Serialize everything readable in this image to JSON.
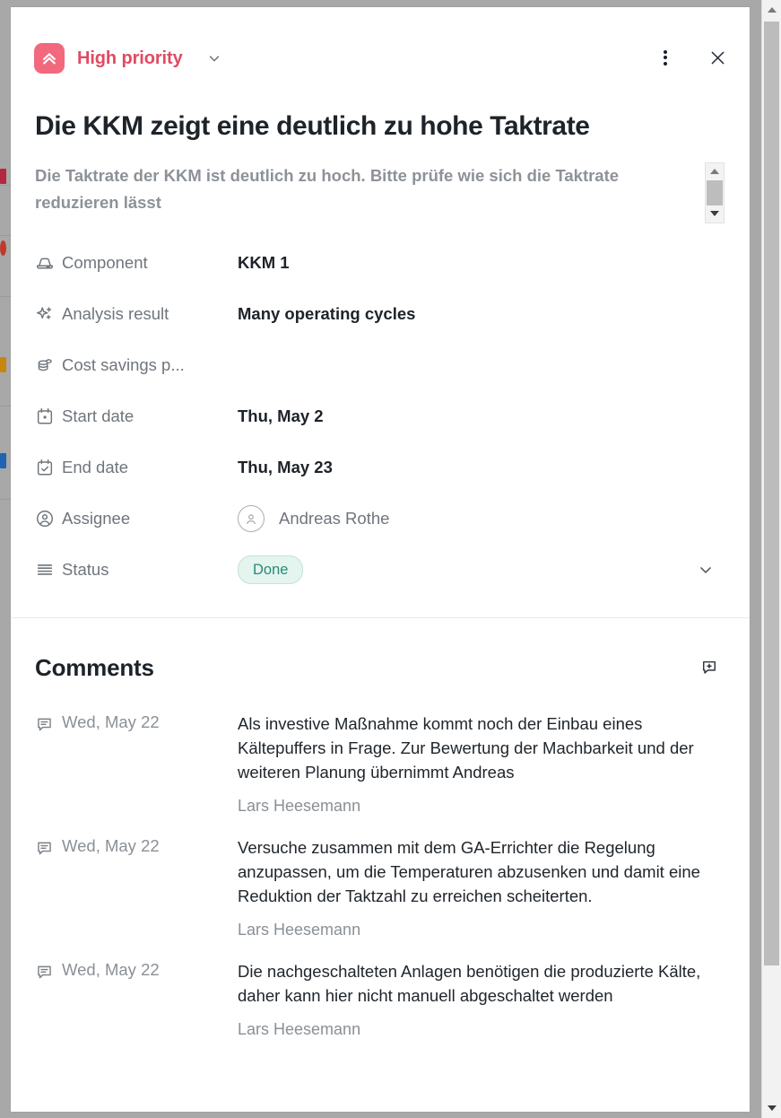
{
  "header": {
    "priority_label": "High priority",
    "priority_icon": "double-chevron-up-icon",
    "priority_color": "#e04a63",
    "priority_badge_color": "#f2687d",
    "caret_icon": "chevron-down-icon",
    "more_icon": "kebab-menu-icon",
    "close_icon": "close-icon"
  },
  "task": {
    "title": "Die KKM zeigt eine deutlich zu hohe Taktrate",
    "description": "Die Taktrate der KKM ist deutlich zu hoch. Bitte prüfe wie sich die Taktrate reduzieren lässt"
  },
  "fields": [
    {
      "icon": "server-icon",
      "label": "Component",
      "value": "KKM 1",
      "style": "bold"
    },
    {
      "icon": "sparkle-icon",
      "label": "Analysis result",
      "value": "Many operating cycles",
      "style": "bold"
    },
    {
      "icon": "coins-icon",
      "label": "Cost savings p...",
      "value": "",
      "style": "bold"
    },
    {
      "icon": "calendar-icon",
      "label": "Start date",
      "value": "Thu, May 2",
      "style": "bold"
    },
    {
      "icon": "calendar-check-icon",
      "label": "End date",
      "value": "Thu, May 23",
      "style": "bold"
    },
    {
      "icon": "user-circle-icon",
      "label": "Assignee",
      "value": "Andreas Rothe",
      "style": "plain"
    },
    {
      "icon": "rows-icon",
      "label": "Status",
      "value": "Done",
      "style": "pill"
    }
  ],
  "status": {
    "badge_text": "Done",
    "badge_bg": "#e4f4ef",
    "badge_text_color": "#2b8a77",
    "caret_icon": "chevron-down-icon"
  },
  "comments": {
    "title": "Comments",
    "add_icon": "add-comment-icon",
    "items": [
      {
        "icon": "comment-icon",
        "date": "Wed, May 22",
        "text": "Als investive Maßnahme kommt noch der Einbau eines Kältepuffers in Frage. Zur Bewertung der Machbarkeit und der weiteren Planung übernimmt Andreas",
        "author": "Lars Heesemann"
      },
      {
        "icon": "comment-icon",
        "date": "Wed, May 22",
        "text": "Versuche zusammen mit dem GA-Errichter die Regelung anzupassen, um die Temperaturen abzusenken und damit eine Reduktion der Taktzahl zu erreichen scheiterten.",
        "author": "Lars Heesemann"
      },
      {
        "icon": "comment-icon",
        "date": "Wed, May 22",
        "text": "Die nachgeschalteten Anlagen benötigen die produzierte Kälte, daher kann hier nicht manuell abgeschaltet werden",
        "author": "Lars Heesemann"
      }
    ]
  },
  "scrollbars": {
    "window_up_icon": "scroll-up-arrow-icon",
    "window_down_icon": "scroll-down-arrow-icon",
    "description_up_icon": "scroll-up-arrow-icon",
    "description_down_icon": "scroll-down-arrow-icon"
  }
}
